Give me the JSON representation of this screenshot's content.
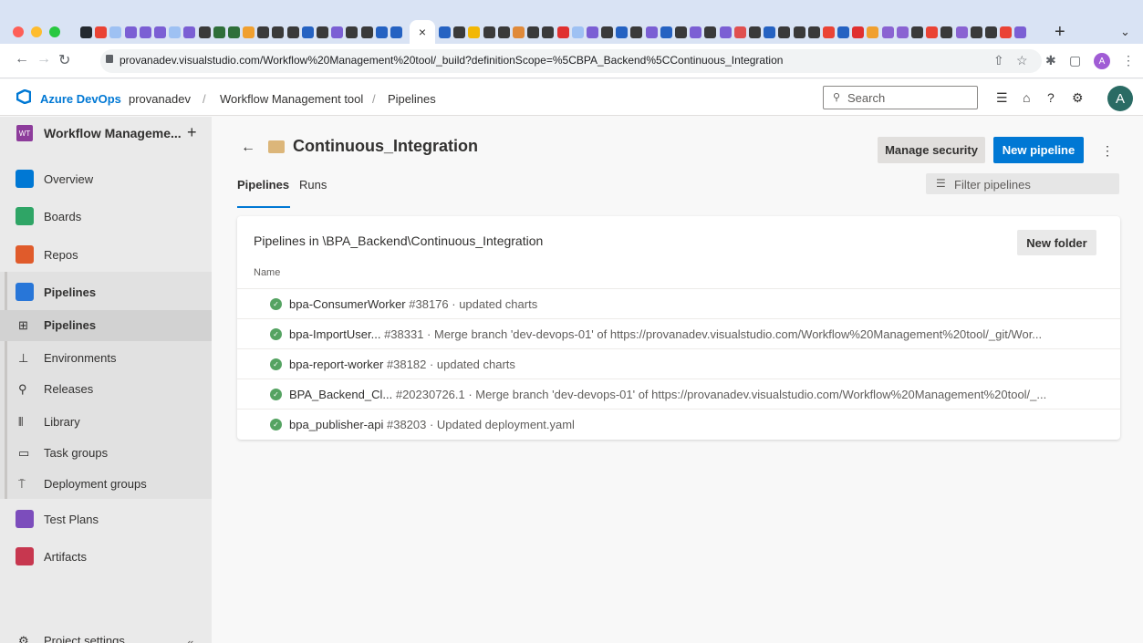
{
  "browser": {
    "url": "provanadev.visualstudio.com/Workflow%20Management%20tool/_build?definitionScope=%5CBPA_Backend%5CContinuous_Integration",
    "profile_initial": "A",
    "tab_close_glyph": "×",
    "new_tab_glyph": "+"
  },
  "header": {
    "product": "Azure DevOps",
    "org": "provanadev",
    "project": "Workflow Management tool",
    "section": "Pipelines",
    "search_placeholder": "Search",
    "avatar_initial": "A"
  },
  "sidebar": {
    "project_badge": "WT",
    "project_name": "Workflow Manageme...",
    "items": [
      {
        "label": "Overview",
        "icon": "overview-icon",
        "color": "#0078d4"
      },
      {
        "label": "Boards",
        "icon": "boards-icon",
        "color": "#2fa566"
      },
      {
        "label": "Repos",
        "icon": "repos-icon",
        "color": "#e05b2b"
      },
      {
        "label": "Pipelines",
        "icon": "pipelines-icon",
        "color": "#2876d8"
      }
    ],
    "subitems": [
      {
        "label": "Pipelines",
        "icon": "pipelines-sub-icon",
        "selected": true
      },
      {
        "label": "Environments",
        "icon": "environments-icon"
      },
      {
        "label": "Releases",
        "icon": "releases-icon"
      },
      {
        "label": "Library",
        "icon": "library-icon"
      },
      {
        "label": "Task groups",
        "icon": "task-groups-icon"
      },
      {
        "label": "Deployment groups",
        "icon": "deployment-groups-icon"
      }
    ],
    "bottom_items": [
      {
        "label": "Test Plans",
        "icon": "test-plans-icon",
        "color": "#7c4dbc"
      },
      {
        "label": "Artifacts",
        "icon": "artifacts-icon",
        "color": "#c7374f"
      }
    ],
    "settings_label": "Project settings"
  },
  "main": {
    "title": "Continuous_Integration",
    "manage_security": "Manage security",
    "new_pipeline": "New pipeline",
    "tabs": [
      {
        "label": "Pipelines",
        "active": true
      },
      {
        "label": "Runs",
        "active": false
      }
    ],
    "filter_placeholder": "Filter pipelines",
    "card_title": "Pipelines in \\BPA_Backend\\Continuous_Integration",
    "new_folder": "New folder",
    "column_name": "Name",
    "pipelines": [
      {
        "name": "bpa-ConsumerWorker",
        "meta": "#38176 · updated charts",
        "status": "succeeded"
      },
      {
        "name": "bpa-ImportUser...",
        "meta": "#38331 · Merge branch 'dev-devops-01' of https://provanadev.visualstudio.com/Workflow%20Management%20tool/_git/Wor...",
        "status": "succeeded"
      },
      {
        "name": "bpa-report-worker",
        "meta": "#38182 · updated charts",
        "status": "succeeded"
      },
      {
        "name": "BPA_Backend_Cl...",
        "meta": "#20230726.1 · Merge branch 'dev-devops-01' of https://provanadev.visualstudio.com/Workflow%20Management%20tool/_...",
        "status": "succeeded"
      },
      {
        "name": "bpa_publisher-api",
        "meta": "#38203 · Updated deployment.yaml",
        "status": "succeeded"
      }
    ]
  },
  "colors": {
    "accent": "#0078d4",
    "success": "#55a362",
    "folder": "#dcb67a"
  }
}
